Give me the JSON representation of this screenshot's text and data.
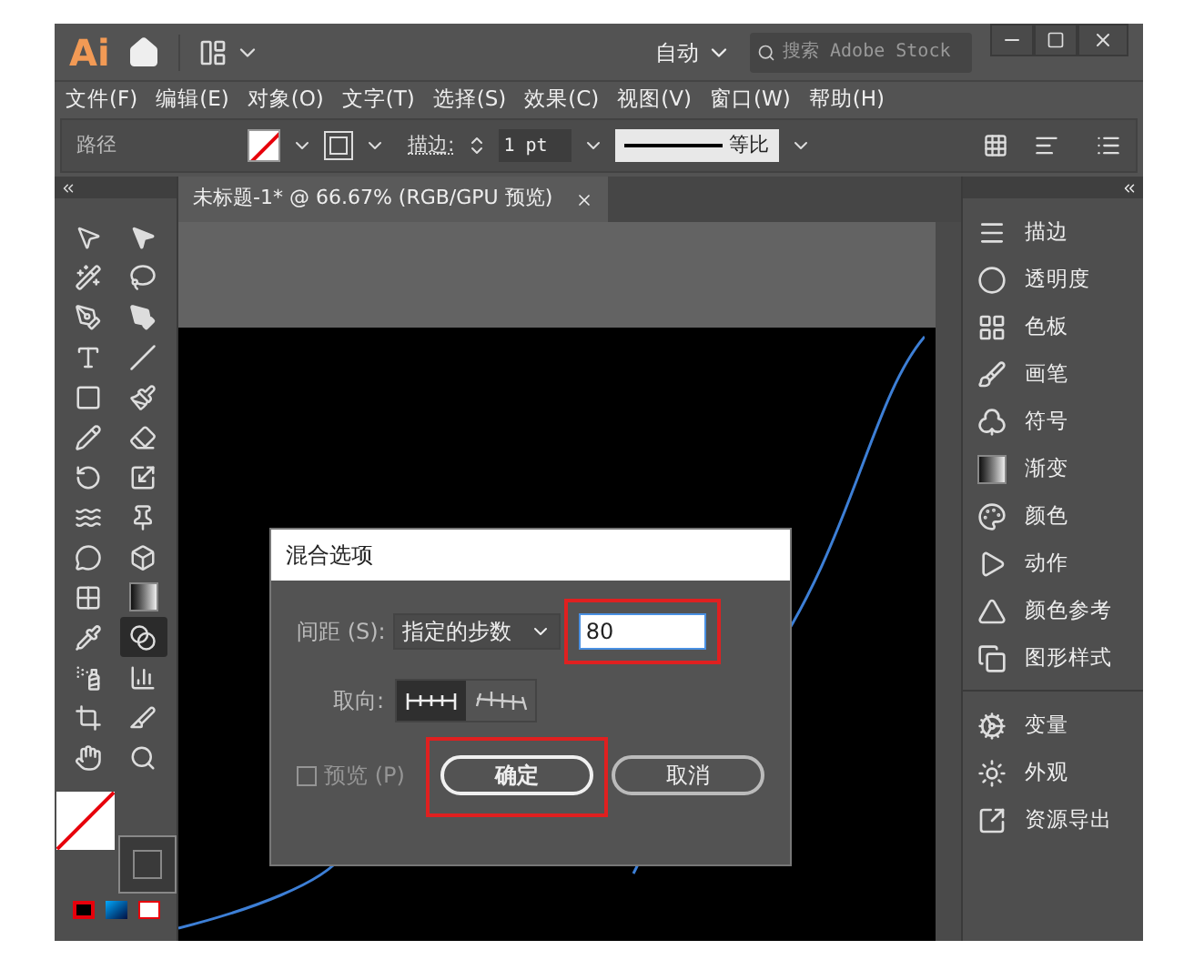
{
  "app": {
    "logo": "Ai"
  },
  "title_bar": {
    "workspace": "自动",
    "search": {
      "placeholder": "搜索 Adobe Stock"
    }
  },
  "menu": [
    {
      "label": "文件(F)"
    },
    {
      "label": "编辑(E)"
    },
    {
      "label": "对象(O)"
    },
    {
      "label": "文字(T)"
    },
    {
      "label": "选择(S)"
    },
    {
      "label": "效果(C)"
    },
    {
      "label": "视图(V)"
    },
    {
      "label": "窗口(W)"
    },
    {
      "label": "帮助(H)"
    }
  ],
  "control_bar": {
    "object_type": "路径",
    "stroke_label": "描边:",
    "stroke_weight": "1 pt",
    "profile": "等比"
  },
  "document_tab": {
    "title": "未标题-1* @ 66.67% (RGB/GPU 预览)"
  },
  "tools": [
    {
      "selected": false
    },
    {
      "selected": false
    },
    {
      "selected": false
    },
    {
      "selected": false
    },
    {
      "selected": false
    },
    {
      "selected": false
    },
    {
      "selected": false
    },
    {
      "selected": false
    },
    {
      "selected": false
    },
    {
      "selected": false
    },
    {
      "selected": false
    },
    {
      "selected": false
    },
    {
      "selected": false
    },
    {
      "selected": false
    },
    {
      "selected": false
    },
    {
      "selected": false
    },
    {
      "selected": false
    },
    {
      "selected": false
    },
    {
      "selected": false
    },
    {
      "selected": false
    },
    {
      "selected": false
    },
    {
      "selected": true
    },
    {
      "selected": false
    },
    {
      "selected": false
    },
    {
      "selected": false
    },
    {
      "selected": false
    },
    {
      "selected": false
    },
    {
      "selected": false
    }
  ],
  "panel_groups": [
    {
      "items": [
        {
          "label": "描边"
        },
        {
          "label": "透明度"
        },
        {
          "label": "色板"
        },
        {
          "label": "画笔"
        },
        {
          "label": "符号"
        },
        {
          "label": "渐变"
        },
        {
          "label": "颜色"
        },
        {
          "label": "动作"
        },
        {
          "label": "颜色参考"
        },
        {
          "label": "图形样式"
        }
      ]
    },
    {
      "items": [
        {
          "label": "变量"
        },
        {
          "label": "外观"
        },
        {
          "label": "资源导出"
        }
      ]
    }
  ],
  "dialog": {
    "title": "混合选项",
    "spacing_label": "间距 (S):",
    "spacing_mode": "指定的步数",
    "steps": "80",
    "orientation_label": "取向:",
    "orientation": [
      {
        "selected": true
      },
      {
        "selected": false
      }
    ],
    "preview": {
      "label": "预览 (P)",
      "checked": false,
      "disabled": true
    },
    "buttons": [
      {
        "label": "确定",
        "primary": true
      },
      {
        "label": "取消",
        "primary": false
      }
    ]
  }
}
